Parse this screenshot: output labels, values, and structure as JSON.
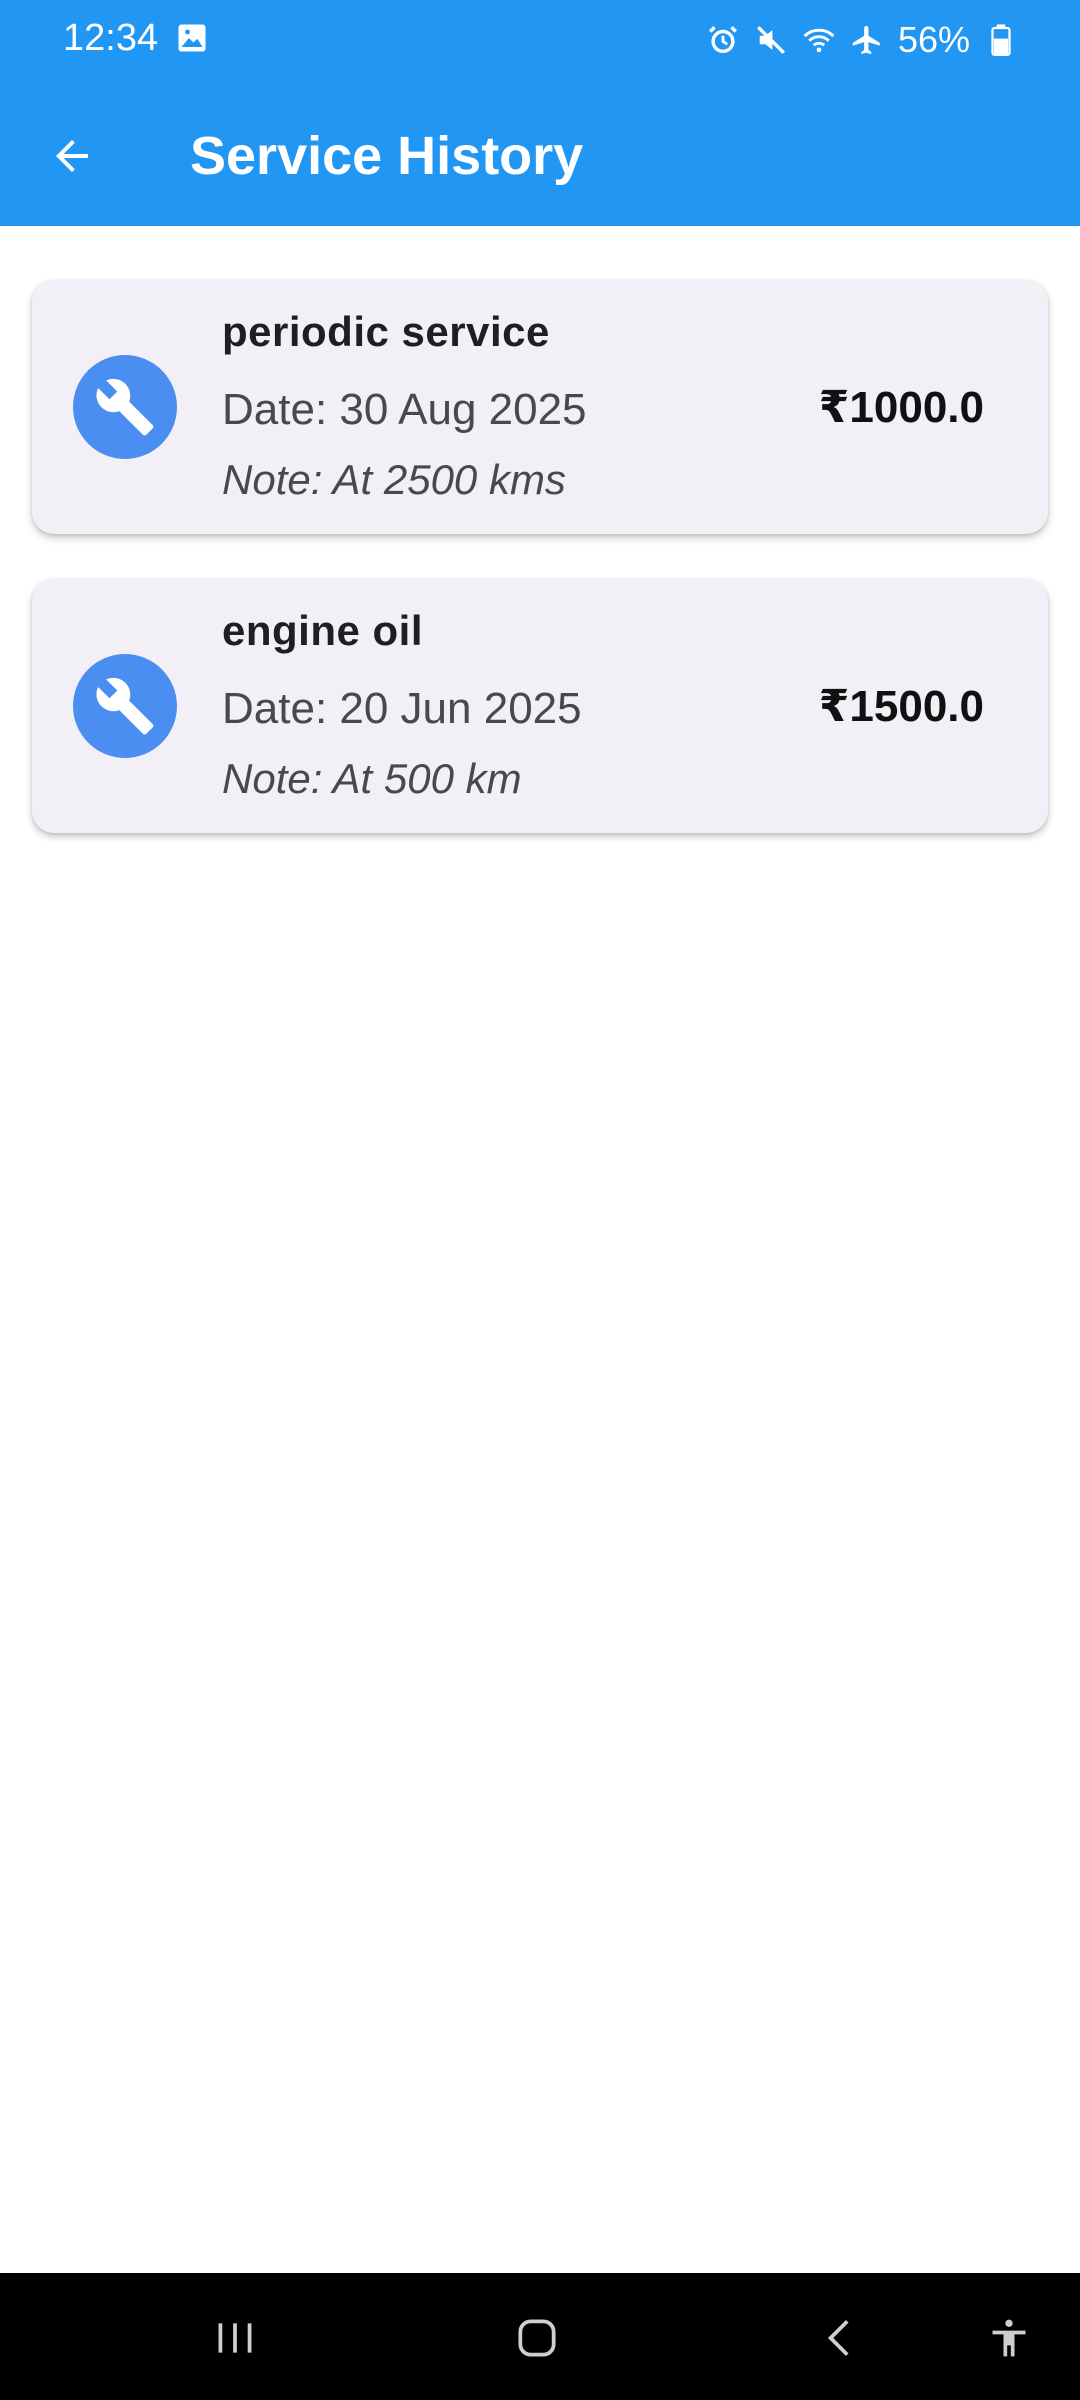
{
  "status_bar": {
    "time": "12:34",
    "battery": "56%",
    "icons": [
      "gallery-icon",
      "alarm-icon",
      "mute-icon",
      "wifi-icon",
      "airplane-icon",
      "battery-icon"
    ]
  },
  "app_bar": {
    "title": "Service History",
    "back_icon": "arrow-left-icon"
  },
  "services": [
    {
      "title": "periodic service",
      "date": "Date: 30 Aug 2025",
      "note": "Note: At 2500 kms",
      "amount": "₹1000.0",
      "icon": "wrench-icon"
    },
    {
      "title": "engine oil",
      "date": "Date: 20 Jun 2025",
      "note": "Note: At 500 km",
      "amount": "₹1500.0",
      "icon": "wrench-icon"
    }
  ],
  "nav_bar": {
    "buttons": [
      "recents-icon",
      "home-icon",
      "back-icon",
      "accessibility-icon"
    ]
  },
  "colors": {
    "app_bar": "#2196F3",
    "card_bg": "#F3EFF6",
    "avatar_bg": "#4A8EF2",
    "nav_bar": "#000000"
  }
}
